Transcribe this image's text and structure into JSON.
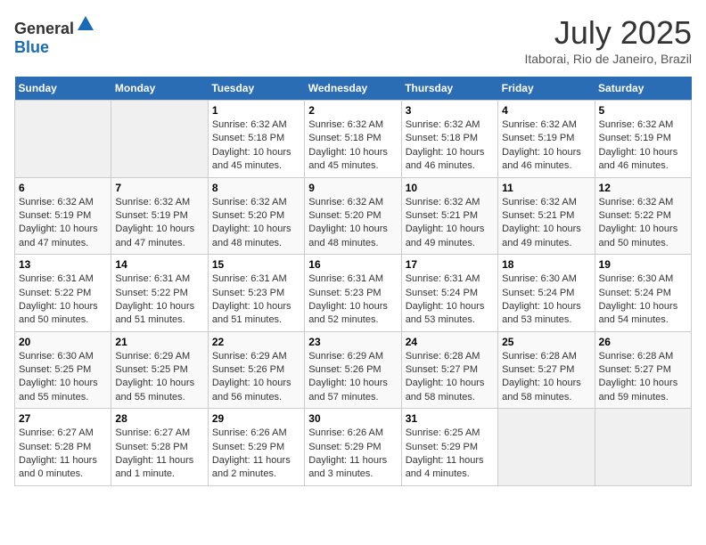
{
  "header": {
    "logo_general": "General",
    "logo_blue": "Blue",
    "title": "July 2025",
    "subtitle": "Itaborai, Rio de Janeiro, Brazil"
  },
  "calendar": {
    "days_of_week": [
      "Sunday",
      "Monday",
      "Tuesday",
      "Wednesday",
      "Thursday",
      "Friday",
      "Saturday"
    ],
    "weeks": [
      [
        {
          "day": "",
          "empty": true
        },
        {
          "day": "",
          "empty": true
        },
        {
          "day": "1",
          "sunrise": "6:32 AM",
          "sunset": "5:18 PM",
          "daylight": "10 hours and 45 minutes."
        },
        {
          "day": "2",
          "sunrise": "6:32 AM",
          "sunset": "5:18 PM",
          "daylight": "10 hours and 45 minutes."
        },
        {
          "day": "3",
          "sunrise": "6:32 AM",
          "sunset": "5:18 PM",
          "daylight": "10 hours and 46 minutes."
        },
        {
          "day": "4",
          "sunrise": "6:32 AM",
          "sunset": "5:19 PM",
          "daylight": "10 hours and 46 minutes."
        },
        {
          "day": "5",
          "sunrise": "6:32 AM",
          "sunset": "5:19 PM",
          "daylight": "10 hours and 46 minutes."
        }
      ],
      [
        {
          "day": "6",
          "sunrise": "6:32 AM",
          "sunset": "5:19 PM",
          "daylight": "10 hours and 47 minutes."
        },
        {
          "day": "7",
          "sunrise": "6:32 AM",
          "sunset": "5:19 PM",
          "daylight": "10 hours and 47 minutes."
        },
        {
          "day": "8",
          "sunrise": "6:32 AM",
          "sunset": "5:20 PM",
          "daylight": "10 hours and 48 minutes."
        },
        {
          "day": "9",
          "sunrise": "6:32 AM",
          "sunset": "5:20 PM",
          "daylight": "10 hours and 48 minutes."
        },
        {
          "day": "10",
          "sunrise": "6:32 AM",
          "sunset": "5:21 PM",
          "daylight": "10 hours and 49 minutes."
        },
        {
          "day": "11",
          "sunrise": "6:32 AM",
          "sunset": "5:21 PM",
          "daylight": "10 hours and 49 minutes."
        },
        {
          "day": "12",
          "sunrise": "6:32 AM",
          "sunset": "5:22 PM",
          "daylight": "10 hours and 50 minutes."
        }
      ],
      [
        {
          "day": "13",
          "sunrise": "6:31 AM",
          "sunset": "5:22 PM",
          "daylight": "10 hours and 50 minutes."
        },
        {
          "day": "14",
          "sunrise": "6:31 AM",
          "sunset": "5:22 PM",
          "daylight": "10 hours and 51 minutes."
        },
        {
          "day": "15",
          "sunrise": "6:31 AM",
          "sunset": "5:23 PM",
          "daylight": "10 hours and 51 minutes."
        },
        {
          "day": "16",
          "sunrise": "6:31 AM",
          "sunset": "5:23 PM",
          "daylight": "10 hours and 52 minutes."
        },
        {
          "day": "17",
          "sunrise": "6:31 AM",
          "sunset": "5:24 PM",
          "daylight": "10 hours and 53 minutes."
        },
        {
          "day": "18",
          "sunrise": "6:30 AM",
          "sunset": "5:24 PM",
          "daylight": "10 hours and 53 minutes."
        },
        {
          "day": "19",
          "sunrise": "6:30 AM",
          "sunset": "5:24 PM",
          "daylight": "10 hours and 54 minutes."
        }
      ],
      [
        {
          "day": "20",
          "sunrise": "6:30 AM",
          "sunset": "5:25 PM",
          "daylight": "10 hours and 55 minutes."
        },
        {
          "day": "21",
          "sunrise": "6:29 AM",
          "sunset": "5:25 PM",
          "daylight": "10 hours and 55 minutes."
        },
        {
          "day": "22",
          "sunrise": "6:29 AM",
          "sunset": "5:26 PM",
          "daylight": "10 hours and 56 minutes."
        },
        {
          "day": "23",
          "sunrise": "6:29 AM",
          "sunset": "5:26 PM",
          "daylight": "10 hours and 57 minutes."
        },
        {
          "day": "24",
          "sunrise": "6:28 AM",
          "sunset": "5:27 PM",
          "daylight": "10 hours and 58 minutes."
        },
        {
          "day": "25",
          "sunrise": "6:28 AM",
          "sunset": "5:27 PM",
          "daylight": "10 hours and 58 minutes."
        },
        {
          "day": "26",
          "sunrise": "6:28 AM",
          "sunset": "5:27 PM",
          "daylight": "10 hours and 59 minutes."
        }
      ],
      [
        {
          "day": "27",
          "sunrise": "6:27 AM",
          "sunset": "5:28 PM",
          "daylight": "11 hours and 0 minutes."
        },
        {
          "day": "28",
          "sunrise": "6:27 AM",
          "sunset": "5:28 PM",
          "daylight": "11 hours and 1 minute."
        },
        {
          "day": "29",
          "sunrise": "6:26 AM",
          "sunset": "5:29 PM",
          "daylight": "11 hours and 2 minutes."
        },
        {
          "day": "30",
          "sunrise": "6:26 AM",
          "sunset": "5:29 PM",
          "daylight": "11 hours and 3 minutes."
        },
        {
          "day": "31",
          "sunrise": "6:25 AM",
          "sunset": "5:29 PM",
          "daylight": "11 hours and 4 minutes."
        },
        {
          "day": "",
          "empty": true
        },
        {
          "day": "",
          "empty": true
        }
      ]
    ],
    "labels": {
      "sunrise": "Sunrise: ",
      "sunset": "Sunset: ",
      "daylight": "Daylight: "
    }
  }
}
